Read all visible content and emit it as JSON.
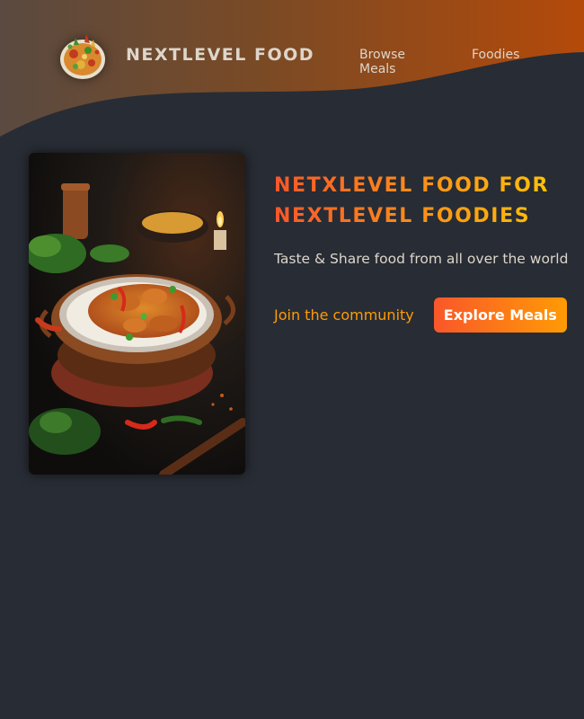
{
  "header": {
    "logo_icon": "food-plate-logo-icon",
    "logo_text": "NEXTLEVEL FOOD",
    "nav": [
      {
        "label": "Browse Meals"
      },
      {
        "label": "Foodies"
      }
    ]
  },
  "hero": {
    "image_icon": "curry-bowl-photo",
    "title_line1": "NETXLEVEL FOOD FOR",
    "title_line2": "NEXTLEVEL FOODIES",
    "subtitle": "Taste & Share food from all over the world",
    "community_link": "Join the community",
    "explore_button": "Explore Meals"
  },
  "colors": {
    "background": "#282c34",
    "accent_start": "#f9572a",
    "accent_end": "#ff9b05",
    "title_end": "#ffc905",
    "text": "#ddd6cb"
  }
}
